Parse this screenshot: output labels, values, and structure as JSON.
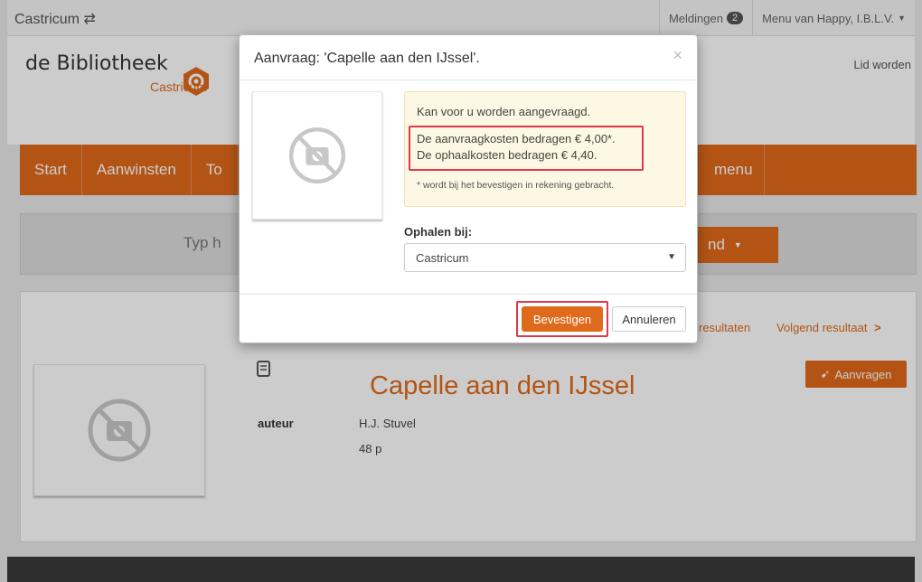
{
  "topbar": {
    "brand": "Castricum",
    "notifications_label": "Meldingen",
    "notifications_count": "2",
    "user_menu": "Menu van Happy, I.B.L.V."
  },
  "header": {
    "logo_text": "de Bibliotheek",
    "logo_sub": "Castricum",
    "register_link": "Lid worden"
  },
  "nav": {
    "items": [
      "Start",
      "Aanwinsten",
      "To"
    ],
    "right_item": "menu"
  },
  "search": {
    "placeholder": "Typ h",
    "button": "nd"
  },
  "record": {
    "title": "Capelle aan den IJssel",
    "author_label": "auteur",
    "author": "H.J. Stuvel",
    "pages": "48 p",
    "request_button": "Aanvragen",
    "results_link": "resultaten",
    "next_link": "Volgend resultaat"
  },
  "modal": {
    "title": "Aanvraag: 'Capelle aan den IJssel'.",
    "close": "×",
    "alert_line1": "Kan voor u worden aangevraagd.",
    "alert_cost1": "De aanvraagkosten bedragen € 4,00*.",
    "alert_cost2": "De ophaalkosten bedragen € 4,40.",
    "alert_note": "* wordt bij het bevestigen in rekening gebracht.",
    "pickup_label": "Ophalen bij:",
    "pickup_value": "Castricum",
    "confirm_button": "Bevestigen",
    "cancel_button": "Annuleren"
  },
  "colors": {
    "accent": "#e06a1b",
    "highlight": "#e0394a",
    "alert_bg": "#fcf8e3"
  }
}
